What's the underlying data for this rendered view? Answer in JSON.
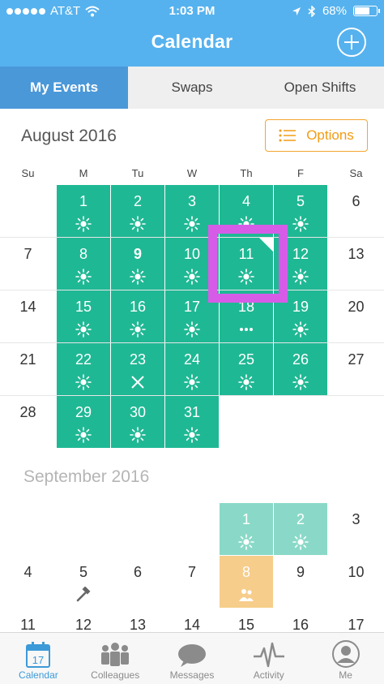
{
  "status_bar": {
    "carrier": "AT&T",
    "time": "1:03 PM",
    "battery": "68%"
  },
  "header": {
    "title": "Calendar"
  },
  "tabs": [
    {
      "label": "My Events",
      "active": true
    },
    {
      "label": "Swaps",
      "active": false
    },
    {
      "label": "Open Shifts",
      "active": false
    }
  ],
  "options_label": "Options",
  "weekdays": [
    "Su",
    "M",
    "Tu",
    "W",
    "Th",
    "F",
    "Sa"
  ],
  "months": [
    {
      "name": "August 2016",
      "weeks": [
        [
          null,
          {
            "day": "1",
            "style": "green",
            "icon": "sun-icon"
          },
          {
            "day": "2",
            "style": "green",
            "icon": "sun-icon"
          },
          {
            "day": "3",
            "style": "green",
            "icon": "sun-icon"
          },
          {
            "day": "4",
            "style": "green",
            "icon": "sun-icon"
          },
          {
            "day": "5",
            "style": "green",
            "icon": "sun-icon"
          },
          {
            "day": "6",
            "style": "plain"
          }
        ],
        [
          {
            "day": "7",
            "style": "plain"
          },
          {
            "day": "8",
            "style": "green",
            "icon": "sun-icon"
          },
          {
            "day": "9",
            "style": "green",
            "icon": "sun-icon",
            "bold": true
          },
          {
            "day": "10",
            "style": "green",
            "icon": "sun-icon"
          },
          {
            "day": "11",
            "style": "green",
            "icon": "sun-icon",
            "corner": true,
            "highlight": true
          },
          {
            "day": "12",
            "style": "green",
            "icon": "sun-icon"
          },
          {
            "day": "13",
            "style": "plain"
          }
        ],
        [
          {
            "day": "14",
            "style": "plain"
          },
          {
            "day": "15",
            "style": "green",
            "icon": "sun-icon"
          },
          {
            "day": "16",
            "style": "green",
            "icon": "sun-icon"
          },
          {
            "day": "17",
            "style": "green",
            "icon": "sun-icon"
          },
          {
            "day": "18",
            "style": "green",
            "icon": "more-dots-icon"
          },
          {
            "day": "19",
            "style": "green",
            "icon": "sun-icon"
          },
          {
            "day": "20",
            "style": "plain"
          }
        ],
        [
          {
            "day": "21",
            "style": "plain"
          },
          {
            "day": "22",
            "style": "green",
            "icon": "sun-icon"
          },
          {
            "day": "23",
            "style": "green",
            "icon": "cross-icon"
          },
          {
            "day": "24",
            "style": "green",
            "icon": "sun-icon"
          },
          {
            "day": "25",
            "style": "green",
            "icon": "sun-icon"
          },
          {
            "day": "26",
            "style": "green",
            "icon": "sun-icon"
          },
          {
            "day": "27",
            "style": "plain"
          }
        ],
        [
          {
            "day": "28",
            "style": "plain"
          },
          {
            "day": "29",
            "style": "green",
            "icon": "sun-icon"
          },
          {
            "day": "30",
            "style": "green",
            "icon": "sun-icon"
          },
          {
            "day": "31",
            "style": "green",
            "icon": "sun-icon"
          },
          null,
          null,
          null
        ]
      ]
    },
    {
      "name": "September 2016",
      "weeks": [
        [
          null,
          null,
          null,
          null,
          {
            "day": "1",
            "style": "light",
            "icon": "sun-icon"
          },
          {
            "day": "2",
            "style": "light",
            "icon": "sun-icon"
          },
          {
            "day": "3",
            "style": "plain"
          }
        ],
        [
          {
            "day": "4",
            "style": "plain"
          },
          {
            "day": "5",
            "style": "plain",
            "icon": "hammer-icon"
          },
          {
            "day": "6",
            "style": "plain"
          },
          {
            "day": "7",
            "style": "plain"
          },
          {
            "day": "8",
            "style": "orange",
            "icon": "users-icon"
          },
          {
            "day": "9",
            "style": "plain"
          },
          {
            "day": "10",
            "style": "plain"
          }
        ],
        [
          {
            "day": "11",
            "style": "plain"
          },
          {
            "day": "12",
            "style": "plain"
          },
          {
            "day": "13",
            "style": "plain"
          },
          {
            "day": "14",
            "style": "plain"
          },
          {
            "day": "15",
            "style": "plain"
          },
          {
            "day": "16",
            "style": "plain"
          },
          {
            "day": "17",
            "style": "plain"
          }
        ]
      ]
    }
  ],
  "bottom_nav": [
    {
      "label": "Calendar",
      "icon": "calendar-icon",
      "badge": "17",
      "active": true
    },
    {
      "label": "Colleagues",
      "icon": "colleagues-icon",
      "active": false
    },
    {
      "label": "Messages",
      "icon": "messages-icon",
      "active": false
    },
    {
      "label": "Activity",
      "icon": "activity-icon",
      "active": false
    },
    {
      "label": "Me",
      "icon": "profile-icon",
      "active": false
    }
  ],
  "colors": {
    "header": "#56b2ee",
    "active_tab": "#4a98d8",
    "event_green": "#1fb894",
    "event_light": "#8ad9c8",
    "event_orange": "#f6cd8a",
    "options_orange": "#f3a531",
    "highlight": "#d65ce8"
  }
}
